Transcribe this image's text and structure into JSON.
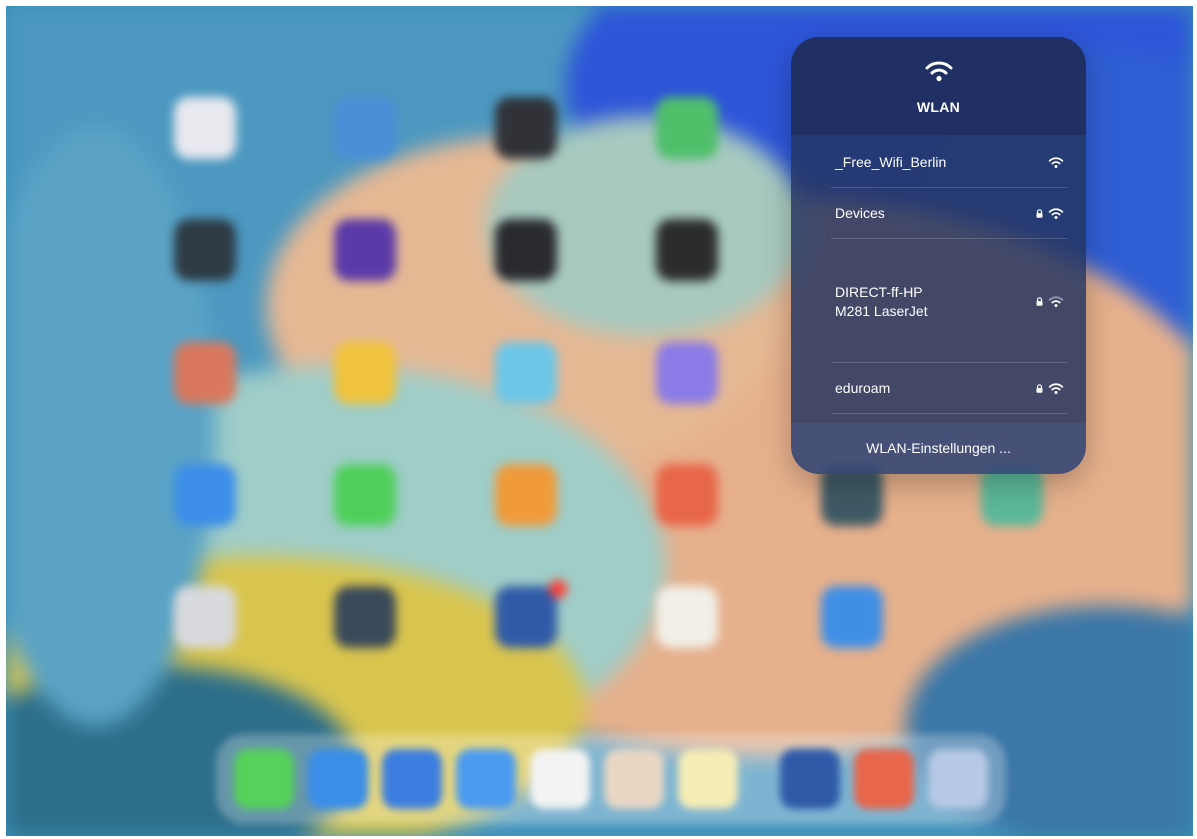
{
  "wlan_panel": {
    "header_icon": "wifi-icon",
    "title": "WLAN",
    "networks": [
      {
        "name": "_Free_Wifi_Berlin",
        "secured": false,
        "signal_icon": "wifi-icon"
      },
      {
        "name": "Devices",
        "secured": true,
        "signal_icon": "wifi-icon"
      },
      {
        "name": "DIRECT-ff-HP\nM281 LaserJet",
        "secured": true,
        "signal_icon": "wifi-icon"
      },
      {
        "name": "eduroam",
        "secured": true,
        "signal_icon": "wifi-icon"
      }
    ],
    "settings_label": "WLAN-Einstellungen ..."
  },
  "colors": {
    "panel_background": "#243460",
    "text": "#ffffff",
    "wallpaper_blue": "#1f5fd0",
    "wallpaper_peach": "#e8b58f",
    "wallpaper_yellow": "#d6c24a"
  }
}
